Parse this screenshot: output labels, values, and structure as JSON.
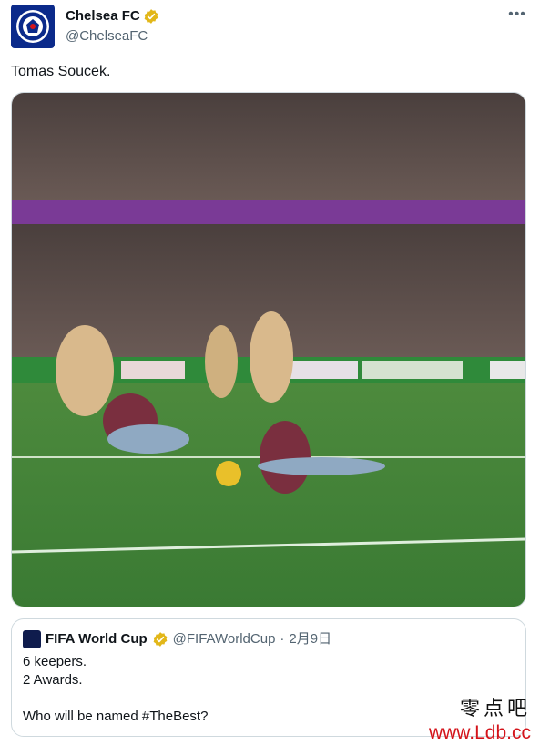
{
  "tweet": {
    "display_name": "Chelsea FC",
    "handle": "@ChelseaFC",
    "verified_color": "#e2b719",
    "more_icon": "more-dots-icon",
    "text": "Tomas Soucek.",
    "media_description_icon": "video-still"
  },
  "quoted_tweet": {
    "display_name": "FIFA World Cup",
    "handle": "@FIFAWorldCup",
    "separator": "·",
    "date": "2月9日",
    "lines": [
      "6 keepers.",
      "2 Awards.",
      "",
      "Who will be named #TheBest?"
    ]
  },
  "watermark": {
    "chinese": "零点吧",
    "url": "www.Ldb.cc"
  }
}
